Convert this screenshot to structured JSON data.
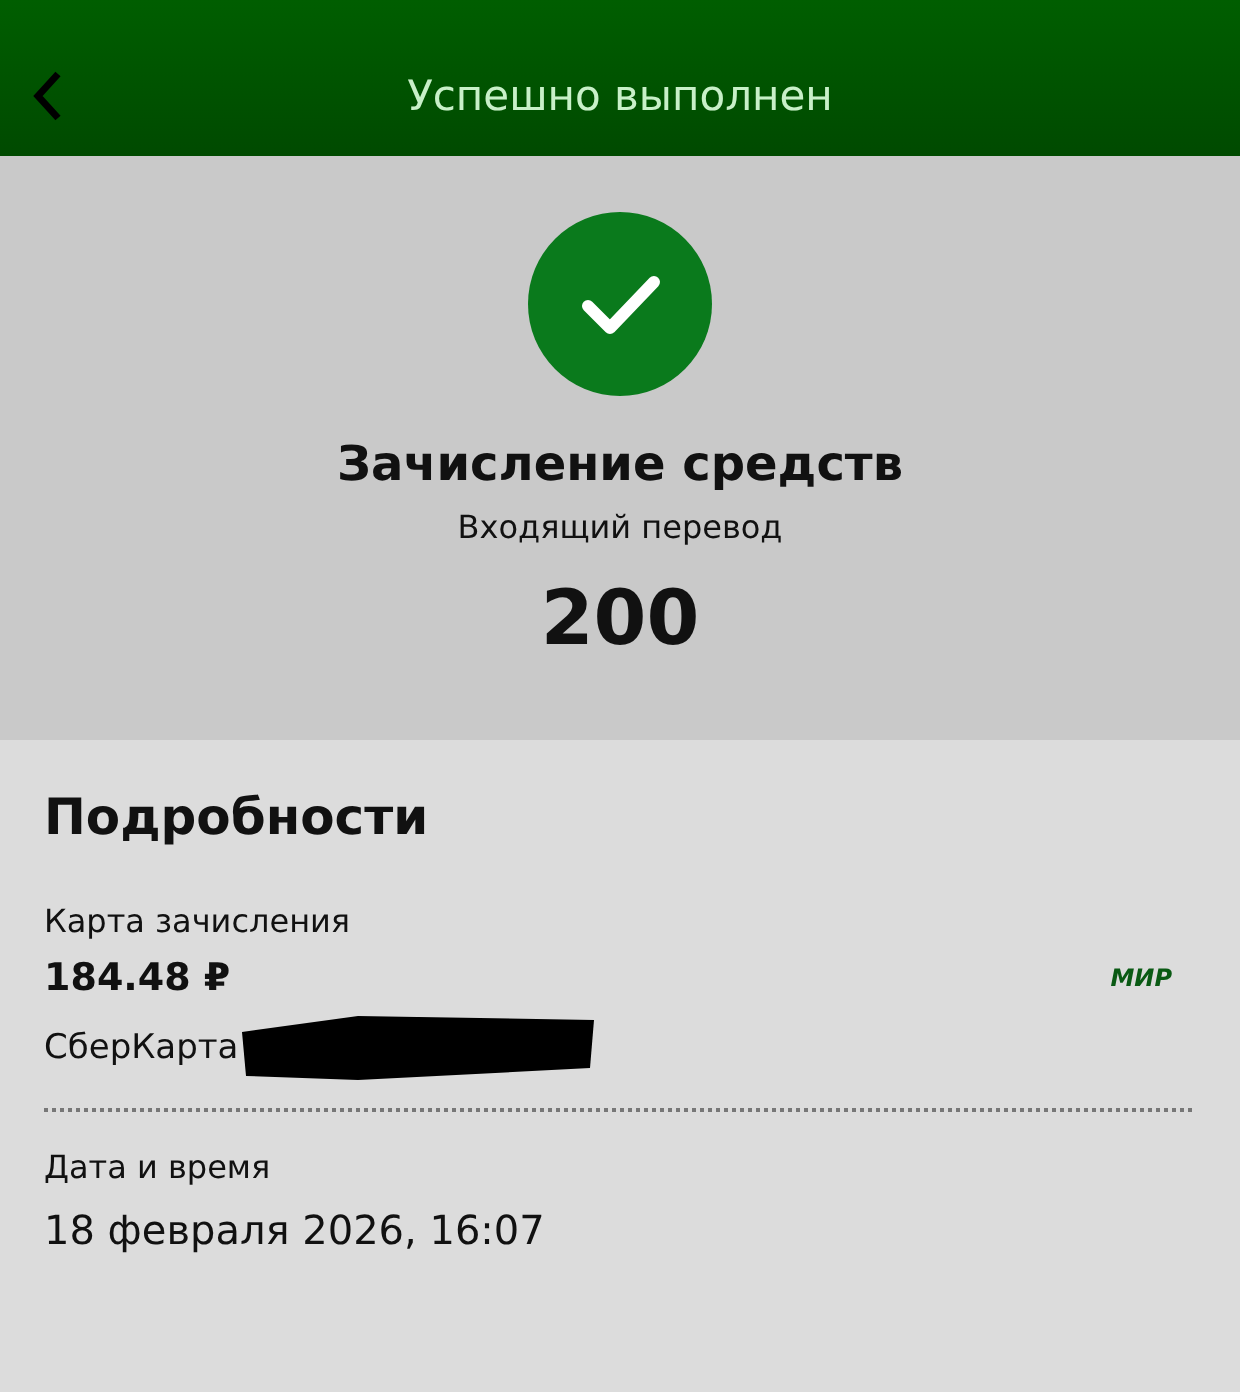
{
  "header": {
    "title": "Успешно выполнен"
  },
  "summary": {
    "title": "Зачисление средств",
    "subtitle": "Входящий перевод",
    "amount": "200"
  },
  "details": {
    "title": "Подробности",
    "items": [
      {
        "kind": "card",
        "label": "Карта зачисления",
        "value": "184.48 ₽",
        "network": "МИР",
        "card_name": "СберКарта",
        "redacted": true
      },
      {
        "kind": "text",
        "label": "Дата и время",
        "value": "18 февраля 2026, 16:07"
      }
    ]
  }
}
